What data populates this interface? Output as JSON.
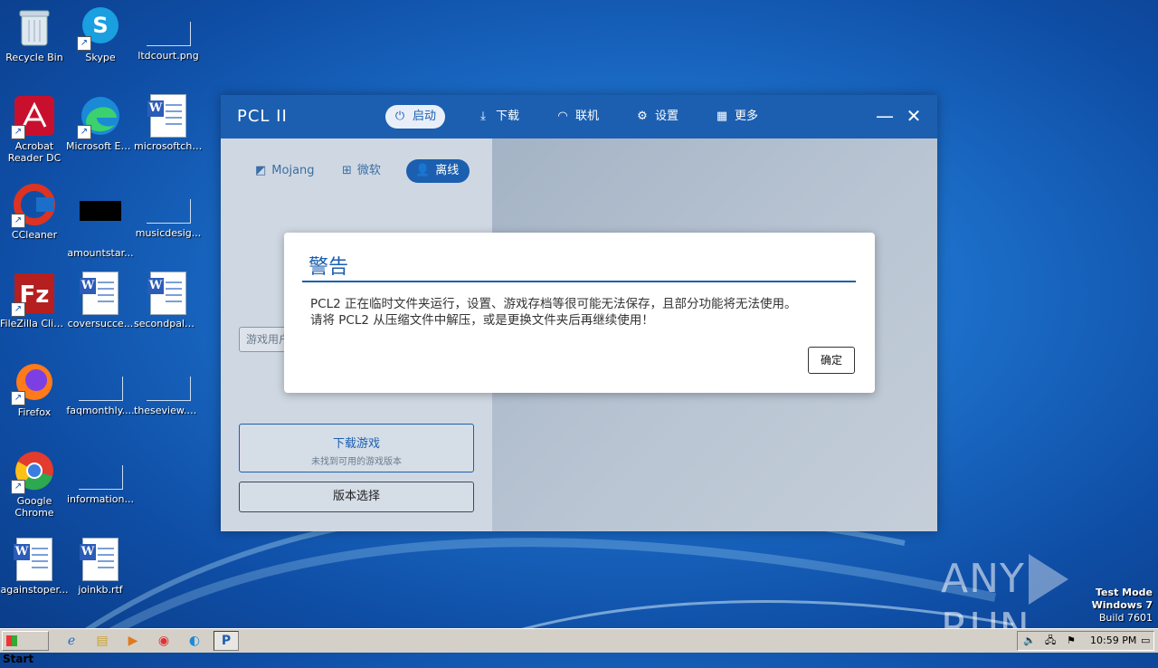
{
  "desktop": {
    "icons": [
      {
        "label": "Recycle Bin"
      },
      {
        "label": "Skype"
      },
      {
        "label": "ltdcourt.png"
      },
      {
        "label": "Acrobat Reader DC"
      },
      {
        "label": "Microsoft Edge"
      },
      {
        "label": "microsoftchi..."
      },
      {
        "label": "CCleaner"
      },
      {
        "label": "amountstar..."
      },
      {
        "label": "musicdesig..."
      },
      {
        "label": "FileZilla Client"
      },
      {
        "label": "coversucce..."
      },
      {
        "label": "secondpalm..."
      },
      {
        "label": "Firefox"
      },
      {
        "label": "faqmonthly...."
      },
      {
        "label": "theseview.png"
      },
      {
        "label": "Google Chrome"
      },
      {
        "label": "information..."
      },
      {
        "label": "againstoper..."
      },
      {
        "label": "joinkb.rtf"
      }
    ]
  },
  "pcl": {
    "title": "PCL II",
    "nav": [
      {
        "label": "启动",
        "icon": "power-icon"
      },
      {
        "label": "下载",
        "icon": "download-icon"
      },
      {
        "label": "联机",
        "icon": "wifi-icon"
      },
      {
        "label": "设置",
        "icon": "gear-icon"
      },
      {
        "label": "更多",
        "icon": "grid-icon"
      }
    ],
    "login_tabs": [
      {
        "label": "Mojang"
      },
      {
        "label": "微软"
      },
      {
        "label": "离线"
      }
    ],
    "username_placeholder": "游戏用户名",
    "download_button": {
      "title": "下载游戏",
      "subtitle": "未找到可用的游戏版本"
    },
    "version_button": "版本选择",
    "accent_color": "#1c5fb0"
  },
  "dialog": {
    "title": "警告",
    "line1": "PCL2 正在临时文件夹运行，设置、游戏存档等很可能无法保存，且部分功能将无法使用。",
    "line2": "请将 PCL2 从压缩文件中解压，或是更换文件夹后再继续使用！",
    "ok": "确定"
  },
  "watermark": {
    "text_left": "ANY",
    "text_right": "RUN",
    "test_mode": "Test Mode",
    "os": "Windows 7",
    "build": "Build 7601"
  },
  "taskbar": {
    "start": "Start",
    "clock": "10:59 PM"
  }
}
